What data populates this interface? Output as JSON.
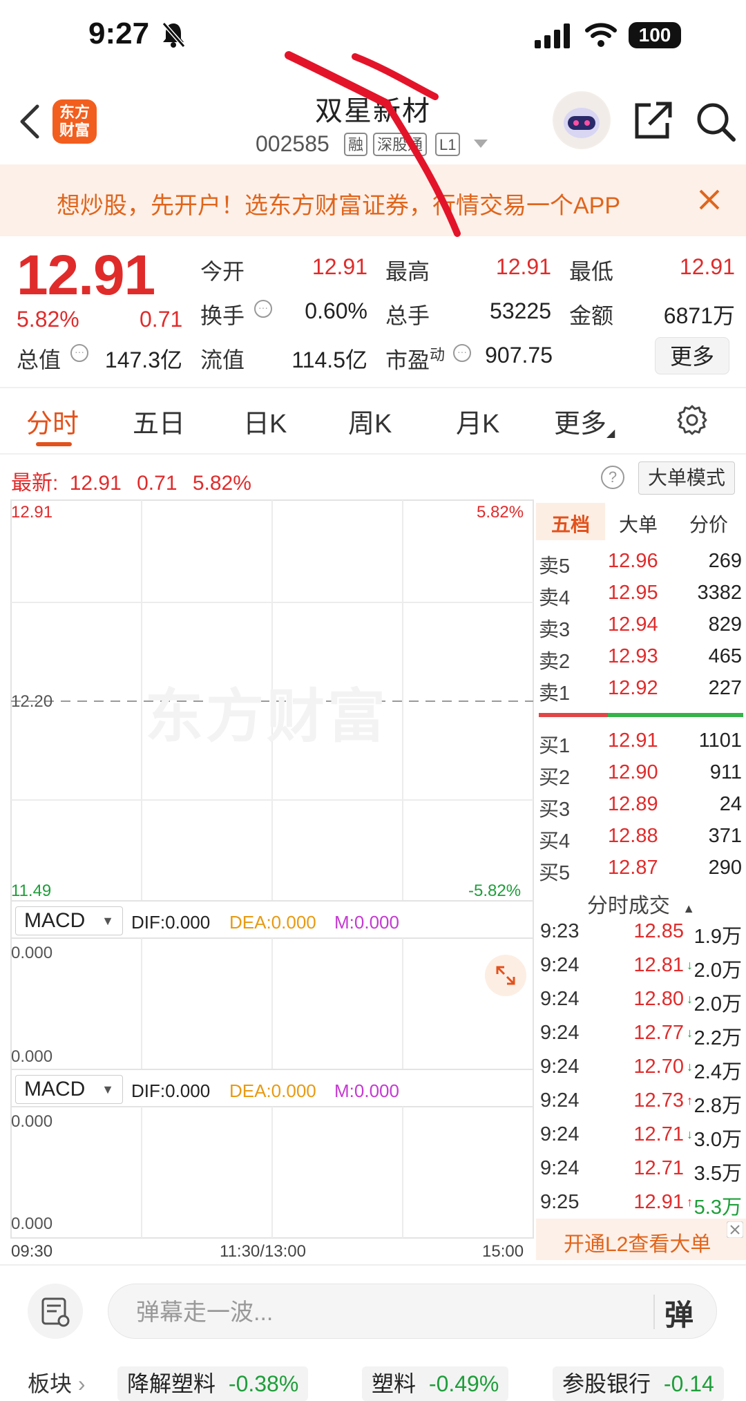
{
  "status_bar": {
    "time": "9:27",
    "battery": "100"
  },
  "header": {
    "app_logo": "东方\n财富",
    "stock_name": "双星新材",
    "stock_code": "002585",
    "tags": [
      "融",
      "深股通",
      "L1"
    ]
  },
  "banner": {
    "text": "想炒股，先开户！选东方财富证券，行情交易一个APP"
  },
  "quote": {
    "price": "12.91",
    "change_pct": "5.82%",
    "change": "0.71",
    "fields": [
      {
        "label": "今开",
        "value": "12.91"
      },
      {
        "label": "最高",
        "value": "12.91"
      },
      {
        "label": "最低",
        "value": "12.91"
      },
      {
        "label": "换手",
        "value": "0.60%"
      },
      {
        "label": "总手",
        "value": "53225"
      },
      {
        "label": "金额",
        "value": "6871万"
      },
      {
        "label": "总值",
        "value": "147.3亿"
      },
      {
        "label": "流值",
        "value": "114.5亿"
      },
      {
        "label": "市盈",
        "label_sup": "动",
        "value": "907.75"
      }
    ],
    "more_label": "更多"
  },
  "tabs": [
    "分时",
    "五日",
    "日K",
    "周K",
    "月K",
    "更多"
  ],
  "latest": {
    "label": "最新:",
    "price": "12.91",
    "change": "0.71",
    "pct": "5.82%"
  },
  "big_order_mode": "大单模式",
  "chart": {
    "watermark": "东方财富",
    "price_top": "12.91",
    "price_mid": "12.20",
    "price_bottom": "11.49",
    "pct_top": "5.82%",
    "pct_bottom": "-5.82%",
    "time_labels": [
      "09:30",
      "11:30/13:00",
      "15:00"
    ]
  },
  "macd_panels": [
    {
      "name": "MACD",
      "dif": "DIF:0.000",
      "dea": "DEA:0.000",
      "m": "M:0.000",
      "top": "0.000",
      "bottom": "0.000"
    },
    {
      "name": "MACD",
      "dif": "DIF:0.000",
      "dea": "DEA:0.000",
      "m": "M:0.000",
      "top": "0.000",
      "bottom": "0.000"
    }
  ],
  "order_book": {
    "tabs": [
      "五档",
      "大单",
      "分价"
    ],
    "asks": [
      {
        "label": "卖5",
        "price": "12.96",
        "vol": "269"
      },
      {
        "label": "卖4",
        "price": "12.95",
        "vol": "3382"
      },
      {
        "label": "卖3",
        "price": "12.94",
        "vol": "829"
      },
      {
        "label": "卖2",
        "price": "12.93",
        "vol": "465"
      },
      {
        "label": "卖1",
        "price": "12.92",
        "vol": "227"
      }
    ],
    "bids": [
      {
        "label": "买1",
        "price": "12.91",
        "vol": "1101"
      },
      {
        "label": "买2",
        "price": "12.90",
        "vol": "911"
      },
      {
        "label": "买3",
        "price": "12.89",
        "vol": "24"
      },
      {
        "label": "买4",
        "price": "12.88",
        "vol": "371"
      },
      {
        "label": "买5",
        "price": "12.87",
        "vol": "290"
      }
    ]
  },
  "trades": {
    "header": "分时成交",
    "rows": [
      {
        "time": "9:23",
        "price": "12.85",
        "arrow": "",
        "vol": "1.9万",
        "vol_color": "#222222"
      },
      {
        "time": "9:24",
        "price": "12.81",
        "arrow": "↓",
        "vol": "2.0万",
        "vol_color": "#222222"
      },
      {
        "time": "9:24",
        "price": "12.80",
        "arrow": "↓",
        "vol": "2.0万",
        "vol_color": "#222222"
      },
      {
        "time": "9:24",
        "price": "12.77",
        "arrow": "↓",
        "vol": "2.2万",
        "vol_color": "#222222"
      },
      {
        "time": "9:24",
        "price": "12.70",
        "arrow": "↓",
        "vol": "2.4万",
        "vol_color": "#222222"
      },
      {
        "time": "9:24",
        "price": "12.73",
        "arrow": "↑",
        "vol": "2.8万",
        "vol_color": "#222222"
      },
      {
        "time": "9:24",
        "price": "12.71",
        "arrow": "↓",
        "vol": "3.0万",
        "vol_color": "#222222"
      },
      {
        "time": "9:24",
        "price": "12.71",
        "arrow": "",
        "vol": "3.5万",
        "vol_color": "#222222"
      },
      {
        "time": "9:25",
        "price": "12.91",
        "arrow": "↑",
        "vol": "5.3万",
        "vol_color": "#1e9e3a"
      }
    ]
  },
  "l2_promo": "开通L2查看大单",
  "comment": {
    "placeholder": "弹幕走一波...",
    "danmu_btn": "弹"
  },
  "sectors": {
    "label": "板块",
    "chips": [
      {
        "name": "降解塑料",
        "pct": "-0.38%"
      },
      {
        "name": "塑料",
        "pct": "-0.49%"
      },
      {
        "name": "参股银行",
        "pct": "-0.14"
      }
    ]
  },
  "colors": {
    "up": "#e02b2b",
    "down": "#1e9e3a",
    "accent": "#e2521c"
  }
}
